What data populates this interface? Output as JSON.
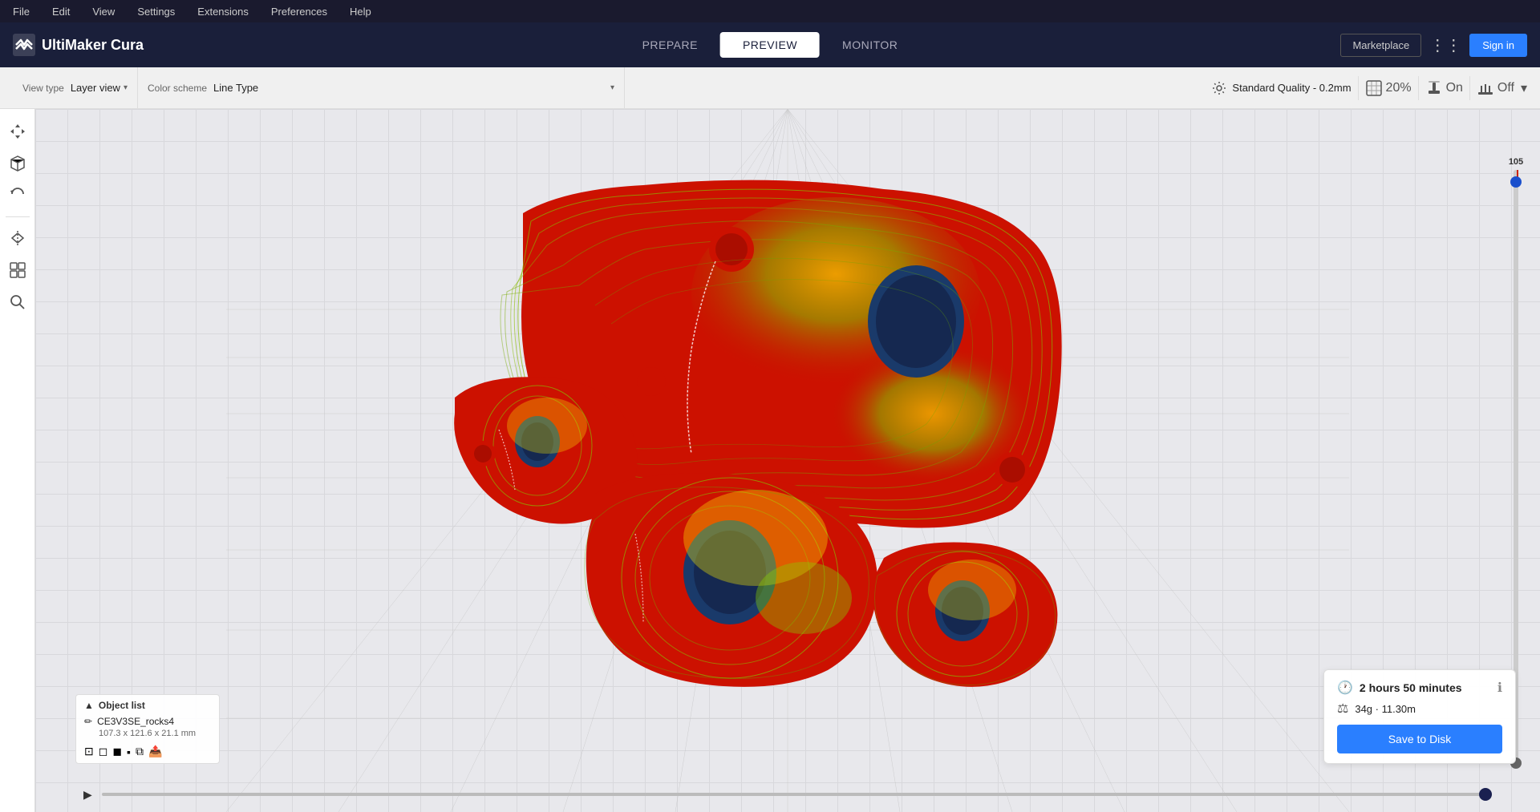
{
  "menu": {
    "items": [
      "File",
      "Edit",
      "View",
      "Settings",
      "Extensions",
      "Preferences",
      "Help"
    ]
  },
  "header": {
    "logo": "UltiMaker Cura",
    "nav": {
      "prepare": "PREPARE",
      "preview": "PREVIEW",
      "monitor": "MONITOR",
      "active": "PREVIEW"
    },
    "marketplace_label": "Marketplace",
    "signin_label": "Sign in"
  },
  "toolbar": {
    "view_type_label": "View type",
    "view_type_value": "Layer view",
    "color_scheme_label": "Color scheme",
    "color_scheme_value": "Line Type",
    "quality_label": "Standard Quality - 0.2mm",
    "infill_pct": "20%",
    "support_label": "On",
    "adhesion_label": "Off"
  },
  "layer_slider": {
    "value": "105"
  },
  "object_list": {
    "header": "Object list",
    "item_name": "CE3V3SE_rocks4",
    "item_dims": "107.3 x 121.6 x 21.1 mm"
  },
  "print_info": {
    "time": "2 hours 50 minutes",
    "material": "34g · 11.30m",
    "save_label": "Save to Disk"
  },
  "icons": {
    "move": "✛",
    "view3d": "⧠",
    "undo": "↩",
    "mirror": "⇔",
    "group": "⊞",
    "search": "🔍",
    "edit_pencil": "✏",
    "chevron_down": "▾",
    "chevron_right": "▸",
    "play": "▶",
    "clock": "🕐",
    "weight": "⚖",
    "info": "ℹ",
    "front": "⊡",
    "box1": "◻",
    "box2": "◼",
    "box3": "▪",
    "copy": "⧉",
    "export": "📤"
  }
}
